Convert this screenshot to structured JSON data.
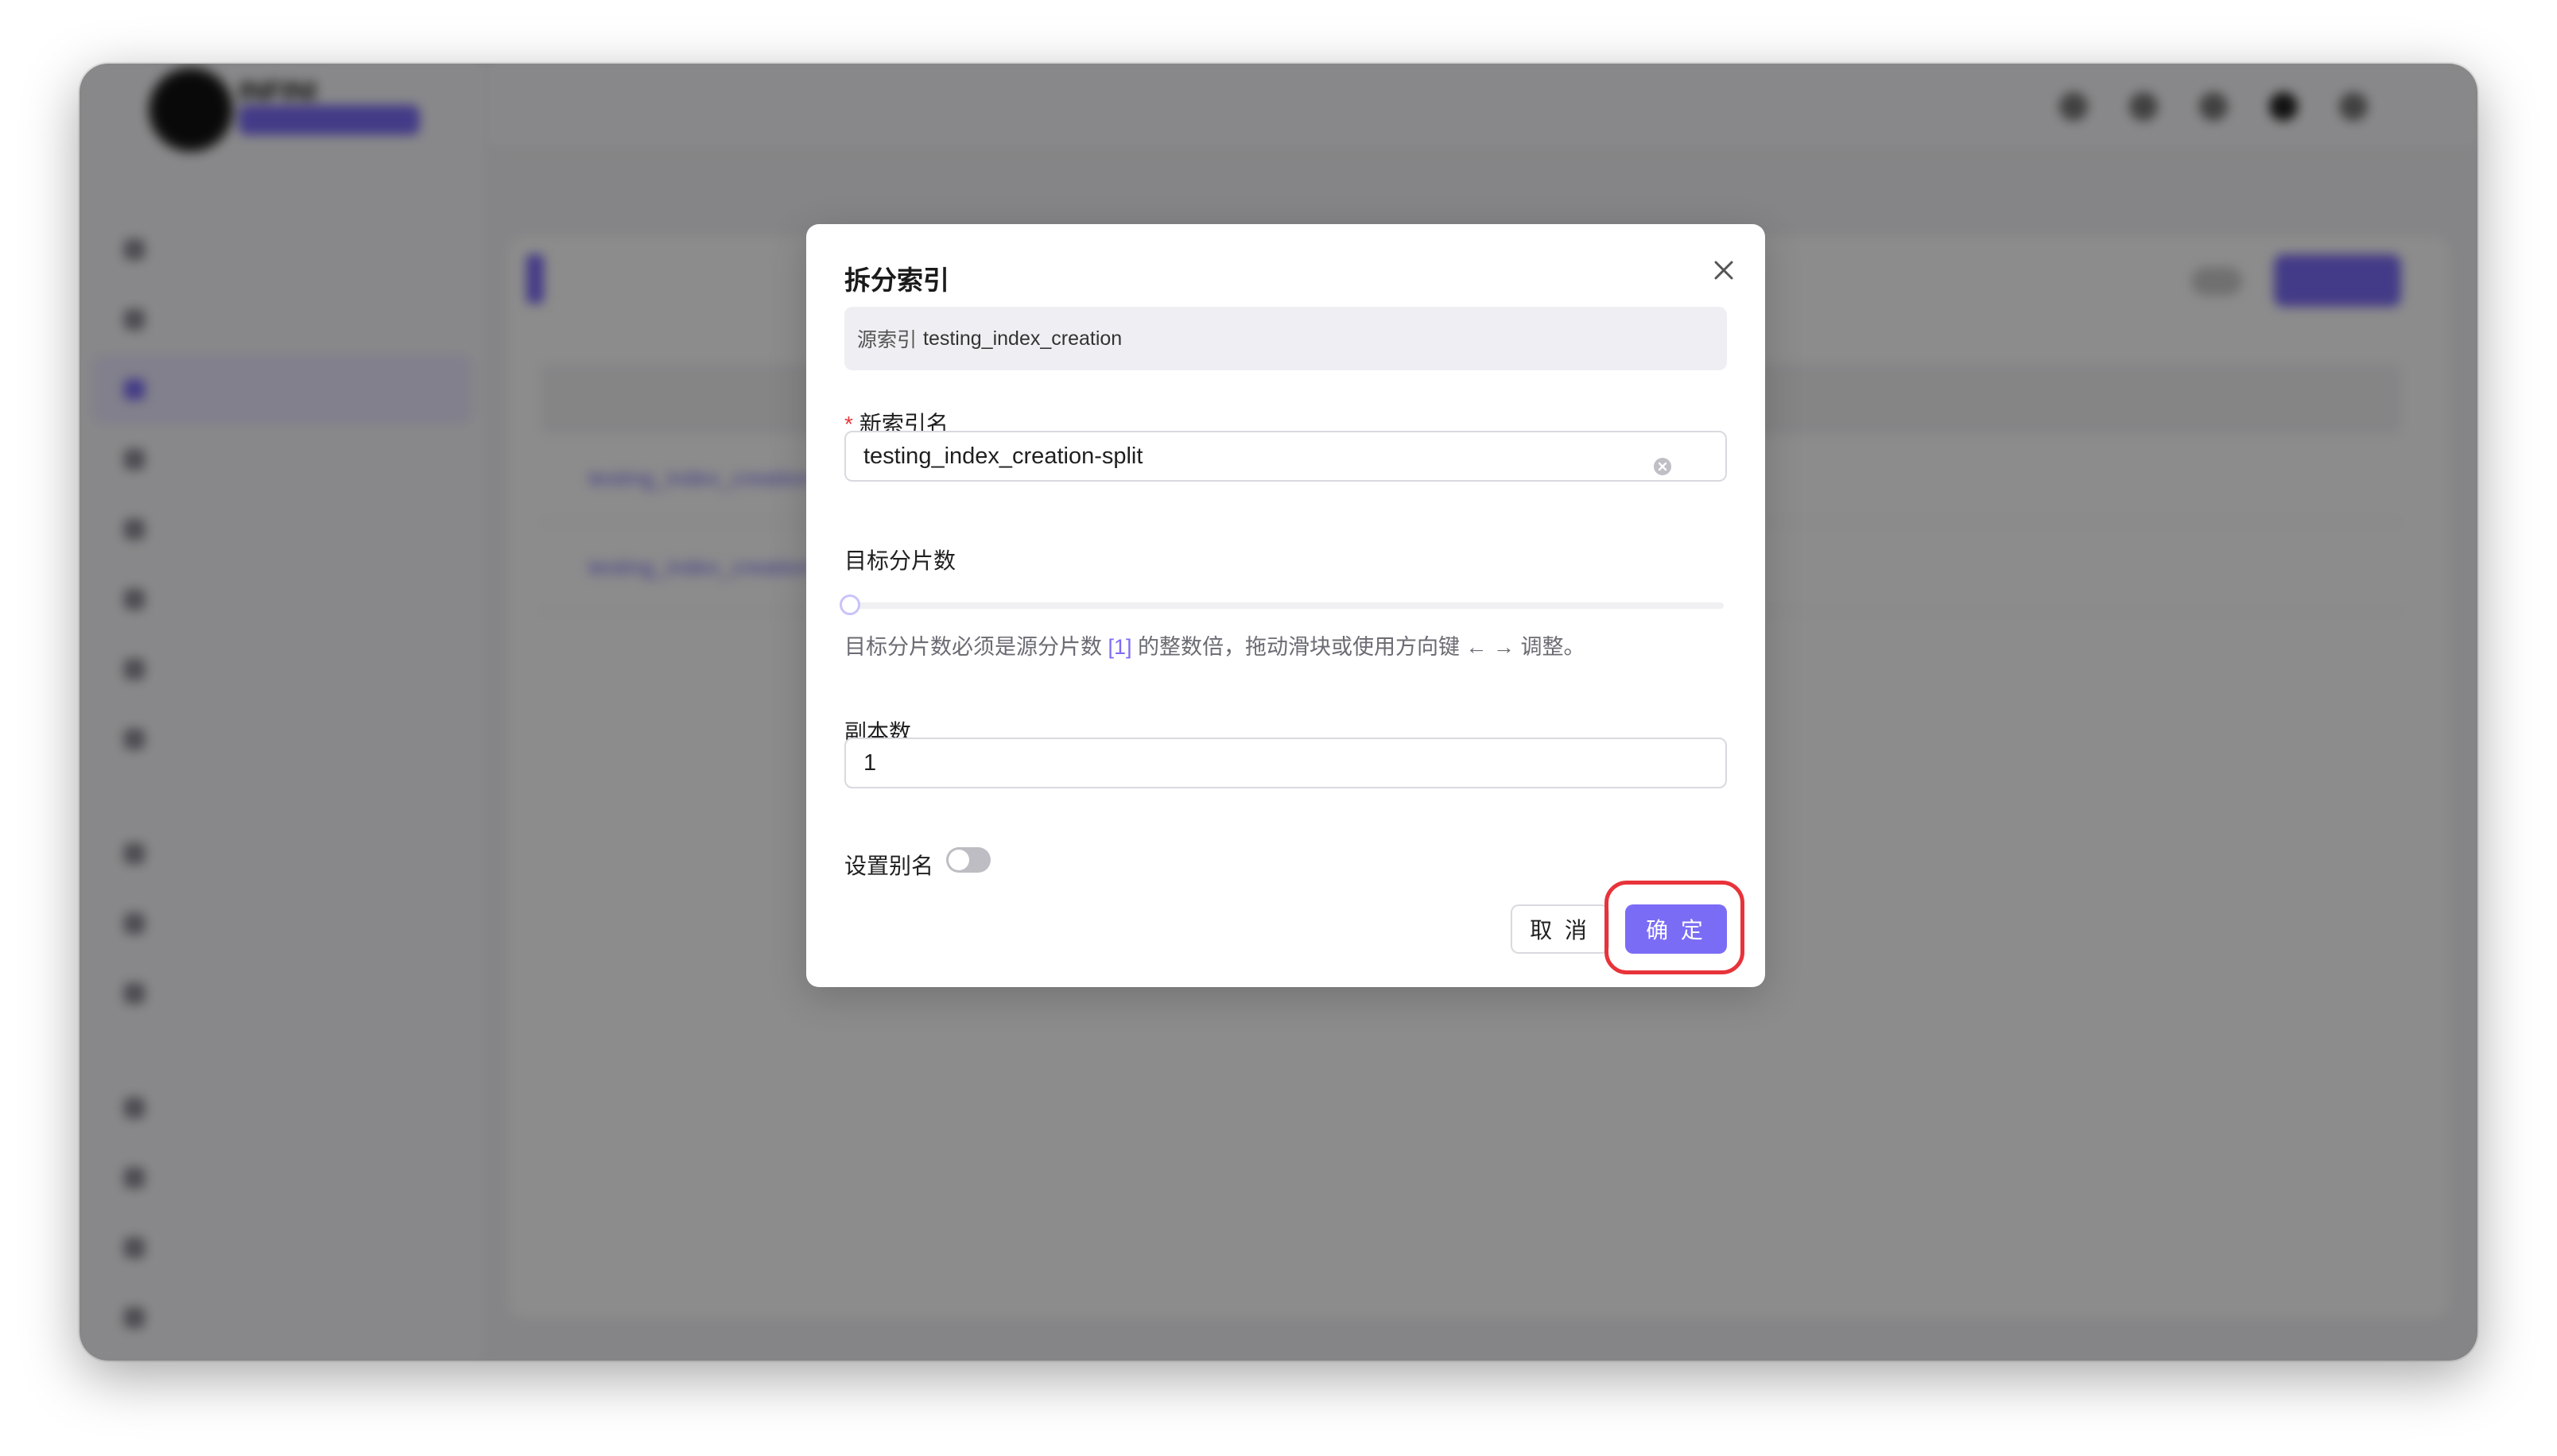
{
  "background_app": {
    "logo_name": "INFINI",
    "logo_version": "",
    "nav_items": [
      "",
      "",
      "",
      "",
      "",
      "",
      "",
      ""
    ],
    "nav_items_lower": [
      "",
      "",
      ""
    ],
    "nav_items_bottom": [
      "",
      "",
      "",
      ""
    ],
    "user": "",
    "breadcrumb": "",
    "create_button": "",
    "toggle_label": "",
    "rows": [
      "testing_index_creation",
      "testing_index_creation"
    ],
    "pager_text": ""
  },
  "modal": {
    "title": "拆分索引",
    "source_label": "源索引",
    "source_index": "testing_index_creation",
    "new_index_required_mark": "*",
    "new_index_label": "新索引名",
    "new_index_value": "testing_index_creation-split",
    "target_shards_label": "目标分片数",
    "target_shards_slider_level": 0,
    "hint_before": "目标分片数必须是源分片数 ",
    "hint_value": "[1]",
    "hint_after": " 的整数倍，拖动滑块或使用方向键 ← → 调整。",
    "replicas_label": "副本数",
    "replicas_value": "1",
    "alias_label": "设置别名",
    "alias_enabled": false,
    "cancel_label": "取 消",
    "confirm_label": "确 定"
  },
  "colors": {
    "primary": "#7b6cf6",
    "highlight_ring": "#e8333a",
    "required": "#e5383b",
    "mask": "rgba(0,0,0,0.45)"
  },
  "icons": {
    "close": "close-icon",
    "clear": "clear-circle-icon"
  }
}
